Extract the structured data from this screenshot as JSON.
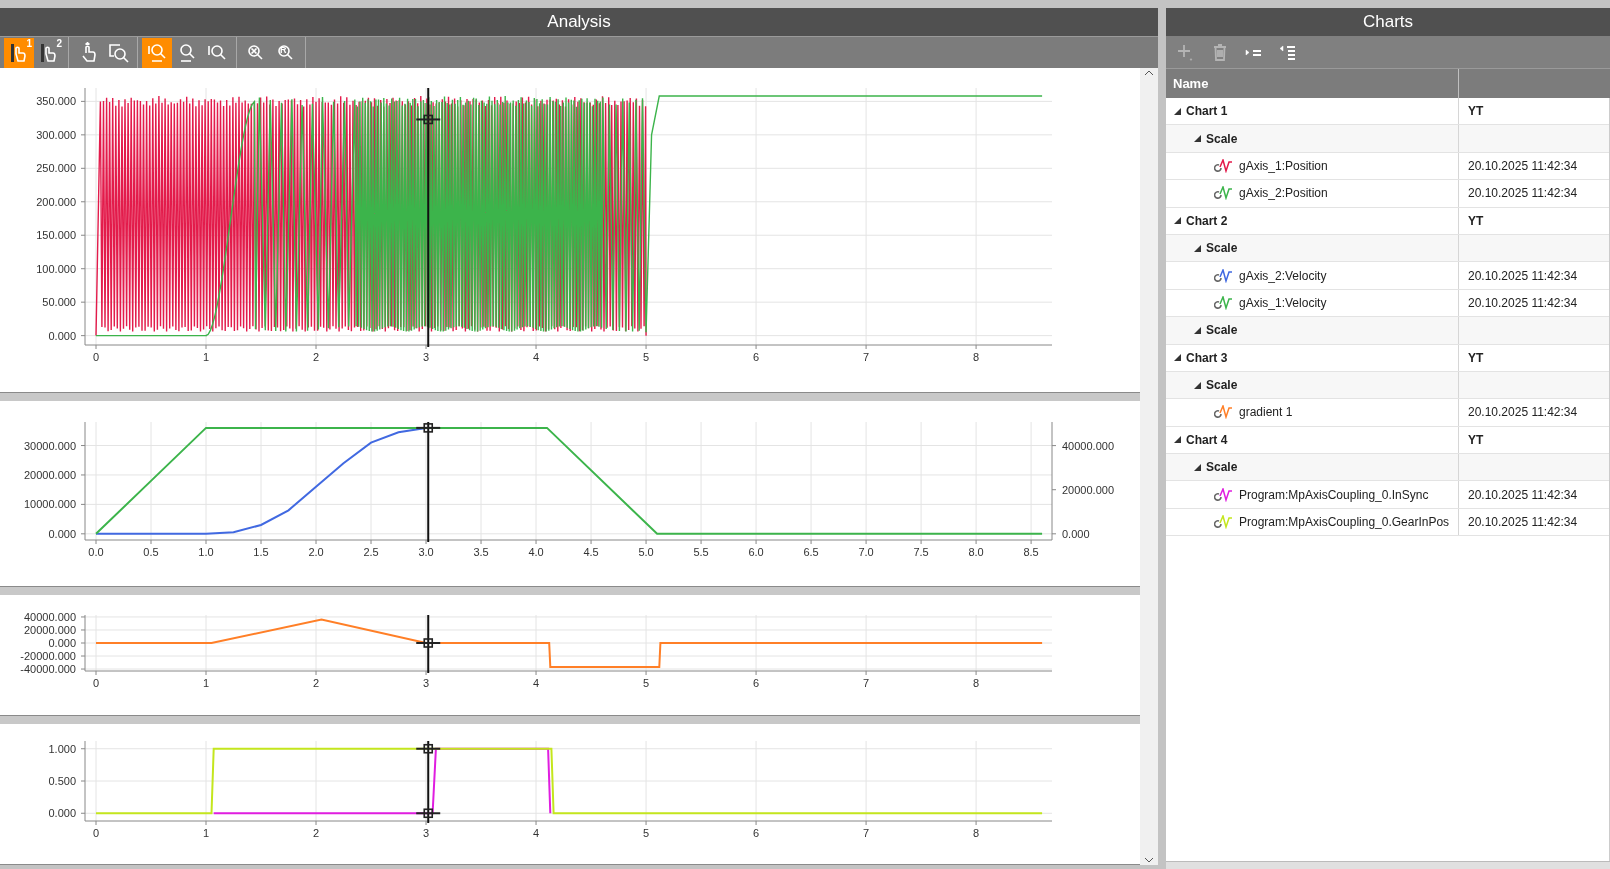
{
  "analysis": {
    "title": "Analysis",
    "toolbar": [
      [
        {
          "kind": "cursor",
          "badge": "1",
          "active": true
        },
        {
          "kind": "cursor",
          "badge": "2",
          "active": false
        }
      ],
      [
        {
          "kind": "pan",
          "active": false
        },
        {
          "kind": "zoom-box",
          "active": false
        }
      ],
      [
        {
          "kind": "zoom-xy",
          "active": true
        },
        {
          "kind": "zoom-x",
          "active": false
        },
        {
          "kind": "zoom-y",
          "active": false
        }
      ],
      [
        {
          "kind": "zoom-clear",
          "active": false
        },
        {
          "kind": "zoom-reset",
          "letter": "R",
          "active": false
        }
      ]
    ],
    "plots": [
      {
        "kind": "waveform",
        "x_tick_labels": [
          "0",
          "1",
          "2",
          "3",
          "4",
          "5",
          "6",
          "7",
          "8"
        ],
        "y_tick_labels": [
          "350.000",
          "300.000",
          "250.000",
          "200.000",
          "150.000",
          "100.000",
          "50.000",
          "0.000"
        ]
      },
      {
        "kind": "chart",
        "chart_data": {
          "type": "line",
          "xlim": [
            -0.1,
            8.69
          ],
          "ylim": [
            -2100,
            38000
          ],
          "x": [
            0,
            0.5,
            1,
            1.25,
            1.5,
            1.75,
            2,
            2.25,
            2.5,
            2.75,
            3,
            4.1,
            5.1,
            8.6
          ],
          "xticks": [
            {
              "value": 0,
              "label": "0.0"
            },
            {
              "value": 0.5,
              "label": "0.5"
            },
            {
              "value": 1,
              "label": "1.0"
            },
            {
              "value": 1.5,
              "label": "1.5"
            },
            {
              "value": 2,
              "label": "2.0"
            },
            {
              "value": 2.5,
              "label": "2.5"
            },
            {
              "value": 3,
              "label": "3.0"
            },
            {
              "value": 3.5,
              "label": "3.5"
            },
            {
              "value": 4,
              "label": "4.0"
            },
            {
              "value": 4.5,
              "label": "4.5"
            },
            {
              "value": 5,
              "label": "5.0"
            },
            {
              "value": 5.5,
              "label": "5.5"
            },
            {
              "value": 6,
              "label": "6.0"
            },
            {
              "value": 6.5,
              "label": "6.5"
            },
            {
              "value": 7,
              "label": "7.0"
            },
            {
              "value": 7.5,
              "label": "7.5"
            },
            {
              "value": 8,
              "label": "8.0"
            },
            {
              "value": 8.5,
              "label": "8.5"
            }
          ],
          "yticks": [
            {
              "value": 0,
              "label": "0.000"
            },
            {
              "value": 10000,
              "label": "10000.000"
            },
            {
              "value": 20000,
              "label": "20000.000"
            },
            {
              "value": 30000,
              "label": "30000.000"
            }
          ],
          "y2lim": [
            -2800,
            50700
          ],
          "y2ticks": [
            {
              "value": 0,
              "label": "0.000"
            },
            {
              "value": 20000,
              "label": "20000.000"
            },
            {
              "value": 40000,
              "label": "40000.000"
            }
          ],
          "series": [
            {
              "color": "#4169e1",
              "values": [
                0,
                0,
                0,
                500,
                3000,
                8000,
                16000,
                24000,
                31000,
                34500,
                36000,
                null,
                null,
                null
              ]
            },
            {
              "color": "#3cb44b",
              "values": [
                0,
                18000,
                36000,
                36000,
                36000,
                36000,
                36000,
                36000,
                36000,
                36000,
                36000,
                36000,
                0,
                0
              ]
            }
          ],
          "grid": true,
          "ref_lines": [
            {
              "axis": "x",
              "value": 3.02,
              "color": "#111111"
            }
          ]
        }
      },
      {
        "kind": "chart",
        "chart_data": {
          "type": "line",
          "xlim": [
            -0.1,
            8.69
          ],
          "ylim": [
            -43000,
            43000
          ],
          "x": [
            0,
            1.05,
            2.05,
            3,
            4.12,
            4.13,
            5.12,
            5.13,
            8.6
          ],
          "xticks": [
            0,
            1,
            2,
            3,
            4,
            5,
            6,
            7,
            8
          ],
          "yticks": [
            {
              "value": -40000,
              "label": "-40000.000"
            },
            {
              "value": -20000,
              "label": "-20000.000"
            },
            {
              "value": 0,
              "label": "0.000"
            },
            {
              "value": 20000,
              "label": "20000.000"
            },
            {
              "value": 40000,
              "label": "40000.000"
            }
          ],
          "series": [
            {
              "color": "#ff7f27",
              "values": [
                0,
                0,
                36000,
                0,
                0,
                -37000,
                -37000,
                0,
                0
              ]
            }
          ],
          "grid": true,
          "ref_lines": [
            {
              "axis": "x",
              "value": 3.02,
              "color": "#111111"
            }
          ]
        }
      },
      {
        "kind": "chart",
        "chart_data": {
          "type": "line",
          "xlim": [
            -0.1,
            8.69
          ],
          "ylim": [
            -0.12,
            1.12
          ],
          "x": [
            0,
            1.05,
            1.07,
            3.06,
            3.09,
            4.11,
            4.13,
            4.14,
            4.16,
            8.6
          ],
          "xticks": [
            0,
            1,
            2,
            3,
            4,
            5,
            6,
            7,
            8
          ],
          "yticks": [
            {
              "value": 0,
              "label": "0.000"
            },
            {
              "value": 0.5,
              "label": "0.500"
            },
            {
              "value": 1,
              "label": "1.000"
            }
          ],
          "series": [
            {
              "color": "#e01ee0",
              "values": [
                null,
                null,
                0,
                0,
                1,
                1,
                0,
                null,
                null,
                null
              ]
            },
            {
              "color": "#c4e61d",
              "values": [
                0,
                0,
                1,
                1,
                1,
                1,
                1,
                1,
                0,
                0
              ]
            }
          ],
          "grid": true,
          "ref_lines": [
            {
              "axis": "x",
              "value": 3.02,
              "color": "#111111"
            }
          ]
        }
      }
    ]
  },
  "charts_panel": {
    "title": "Charts",
    "toolbar": [
      {
        "kind": "add",
        "disabled": true
      },
      {
        "kind": "delete",
        "disabled": true
      },
      {
        "kind": "expand-all",
        "disabled": false
      },
      {
        "kind": "collapse-all",
        "disabled": false
      }
    ],
    "columns": [
      "Name"
    ],
    "tree": [
      {
        "kind": "chart",
        "label": "Chart 1",
        "value": "YT",
        "expanded": true,
        "children": [
          {
            "kind": "scale",
            "label": "Scale",
            "expanded": true,
            "children": [
              {
                "kind": "signal",
                "label": "gAxis_1:Position",
                "value": "20.10.2025 11:42:34",
                "color": "#e31b4b"
              },
              {
                "kind": "signal",
                "label": "gAxis_2:Position",
                "value": "20.10.2025 11:42:34",
                "color": "#3cb44b"
              }
            ]
          }
        ]
      },
      {
        "kind": "chart",
        "label": "Chart 2",
        "value": "YT",
        "expanded": true,
        "children": [
          {
            "kind": "scale",
            "label": "Scale",
            "expanded": true,
            "children": [
              {
                "kind": "signal",
                "label": "gAxis_2:Velocity",
                "value": "20.10.2025 11:42:34",
                "color": "#4169e1"
              },
              {
                "kind": "signal",
                "label": "gAxis_1:Velocity",
                "value": "20.10.2025 11:42:34",
                "color": "#3cb44b"
              }
            ]
          },
          {
            "kind": "scale",
            "label": "Scale",
            "expanded": true
          }
        ]
      },
      {
        "kind": "chart",
        "label": "Chart 3",
        "value": "YT",
        "expanded": true,
        "children": [
          {
            "kind": "scale",
            "label": "Scale",
            "expanded": true,
            "children": [
              {
                "kind": "signal",
                "label": "gradient 1",
                "value": "20.10.2025 11:42:34",
                "color": "#ff7f27"
              }
            ]
          }
        ]
      },
      {
        "kind": "chart",
        "label": "Chart 4",
        "value": "YT",
        "expanded": true,
        "children": [
          {
            "kind": "scale",
            "label": "Scale",
            "expanded": true,
            "children": [
              {
                "kind": "signal",
                "label": "Program:MpAxisCoupling_0.InSync",
                "value": "20.10.2025 11:42:34",
                "color": "#e01ee0"
              },
              {
                "kind": "signal",
                "label": "Program:MpAxisCoupling_0.GearInPos",
                "value": "20.10.2025 11:42:34",
                "color": "#c4e61d"
              }
            ]
          }
        ]
      }
    ]
  }
}
